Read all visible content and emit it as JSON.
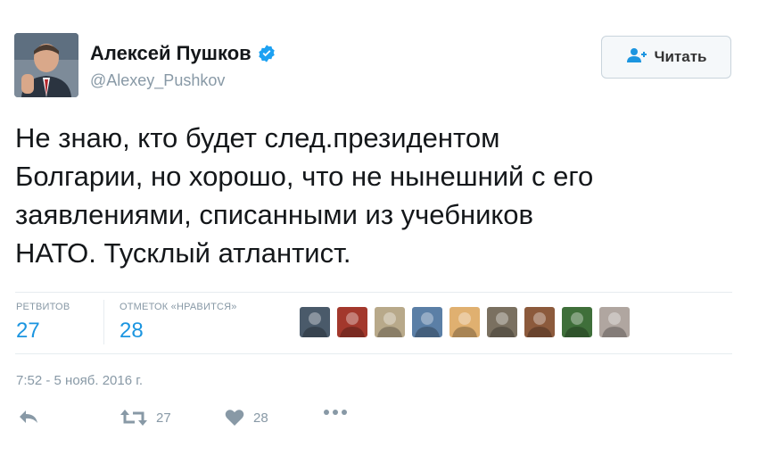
{
  "header": {
    "display_name": "Алексей Пушков",
    "handle": "@Alexey_Pushkov",
    "verified_icon": "verified-badge-icon",
    "follow_label": "Читать"
  },
  "tweet": {
    "text": "Не знаю, кто будет след.президентом\nБолгарии, но хорошо, что не нынешний с его\nзаявлениями, списанными из учебников\nНАТО. Тусклый атлантист."
  },
  "stats": {
    "retweets_label": "РЕТВИТОВ",
    "retweets_count": "27",
    "likes_label": "ОТМЕТОК «НРАВИТСЯ»",
    "likes_count": "28"
  },
  "likers": [
    {
      "name": "liker-avatar-1",
      "color": "#4a5a6a"
    },
    {
      "name": "liker-avatar-2",
      "color": "#a3382c"
    },
    {
      "name": "liker-avatar-3",
      "color": "#b8a98a"
    },
    {
      "name": "liker-avatar-4",
      "color": "#5b7fa6"
    },
    {
      "name": "liker-avatar-5",
      "color": "#e0b070"
    },
    {
      "name": "liker-avatar-6",
      "color": "#7a7060"
    },
    {
      "name": "liker-avatar-7",
      "color": "#8c5a3c"
    },
    {
      "name": "liker-avatar-8",
      "color": "#3f6f3a"
    },
    {
      "name": "liker-avatar-9",
      "color": "#b0a6a0"
    }
  ],
  "timestamp": "7:52 - 5 нояб. 2016 г.",
  "actions": {
    "reply_icon": "reply-icon",
    "retweet_icon": "retweet-icon",
    "retweet_count": "27",
    "like_icon": "heart-icon",
    "like_count": "28",
    "more_icon": "more-dots-icon"
  },
  "colors": {
    "accent": "#1b95e0",
    "muted": "#8899a6",
    "verified": "#1da1f2"
  }
}
